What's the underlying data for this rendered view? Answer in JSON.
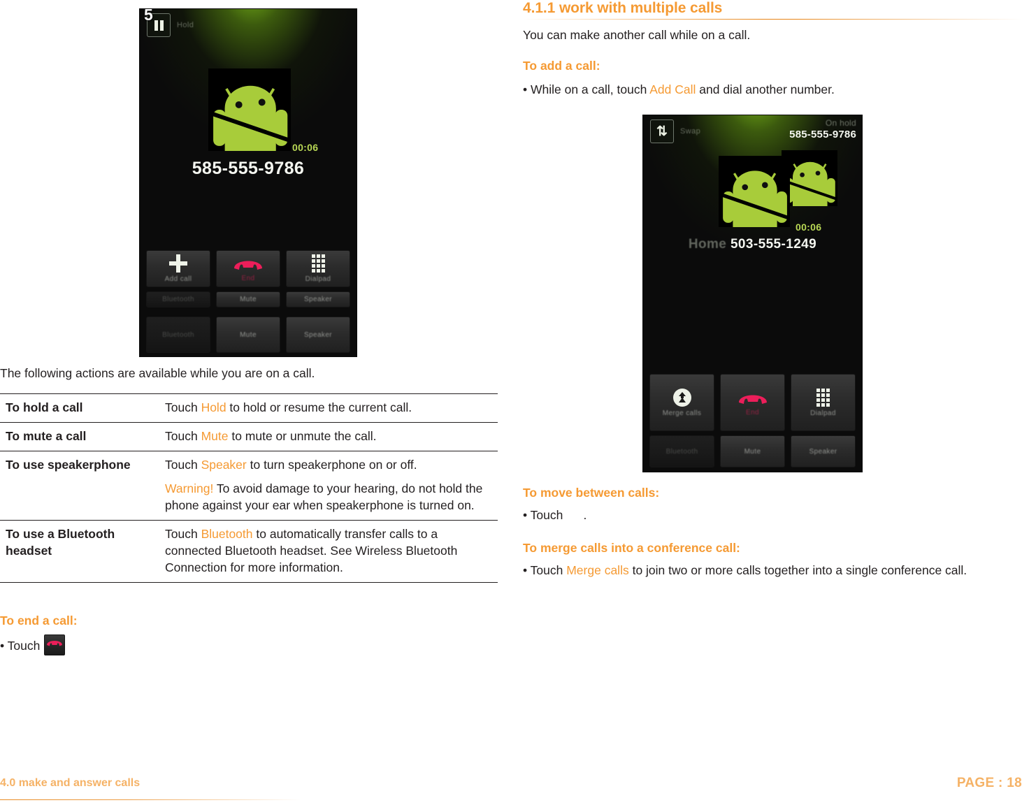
{
  "document": {
    "left_column": {
      "intro": "The following actions are available while you are on a call.",
      "table": {
        "rows": [
          {
            "key": "To hold a call",
            "lines": [
              [
                {
                  "t": "Touch ",
                  "c": "n"
                },
                {
                  "t": "Hold",
                  "c": "o"
                },
                {
                  "t": " to hold or resume the current call.",
                  "c": "n"
                }
              ]
            ]
          },
          {
            "key": "To mute a call",
            "lines": [
              [
                {
                  "t": "Touch ",
                  "c": "n"
                },
                {
                  "t": "Mute",
                  "c": "o"
                },
                {
                  "t": " to mute or unmute the call.",
                  "c": "n"
                }
              ]
            ]
          },
          {
            "key": "To use speakerphone",
            "lines": [
              [
                {
                  "t": "Touch ",
                  "c": "n"
                },
                {
                  "t": "Speaker",
                  "c": "o"
                },
                {
                  "t": " to turn speakerphone on or off.",
                  "c": "n"
                }
              ],
              [
                {
                  "t": "Warning!",
                  "c": "o"
                },
                {
                  "t": " To avoid damage to your hearing, do not hold the phone against your ear when speakerphone is turned on.",
                  "c": "n"
                }
              ]
            ]
          },
          {
            "key": "To use a Bluetooth headset",
            "lines": [
              [
                {
                  "t": "Touch ",
                  "c": "n"
                },
                {
                  "t": "Bluetooth",
                  "c": "o"
                },
                {
                  "t": " to automatically transfer calls to a connected Bluetooth headset. See Wireless Bluetooth Connection for more information.",
                  "c": "n"
                }
              ]
            ]
          }
        ]
      },
      "end_call_heading": "To end a call:",
      "end_call_bullet": "• Touch"
    },
    "right_column": {
      "section_heading": "4.1.1 work with multiple calls",
      "intro": "You can make another call while on a call.",
      "add_call_heading": "To add a call:",
      "add_call_bullet": [
        {
          "t": "• While on a call, touch ",
          "c": "n"
        },
        {
          "t": "Add Call",
          "c": "o"
        },
        {
          "t": " and dial another number.",
          "c": "n"
        }
      ],
      "move_heading": "To move between calls:",
      "move_bullet": "• Touch      .",
      "merge_heading": "To merge calls into a conference call:",
      "merge_bullet": [
        {
          "t": "• Touch ",
          "c": "n"
        },
        {
          "t": "Merge calls",
          "c": "o"
        },
        {
          "t": " to join two or more calls together into a single conference call.",
          "c": "n"
        }
      ]
    },
    "footer": {
      "left": "4.0 make and answer calls",
      "right": "PAGE : 18"
    }
  },
  "screenshot_one": {
    "callout_marker": "5",
    "hold_button_label": "Hold",
    "phone_number": "585-555-9786",
    "timer": "00:06",
    "buttons": [
      {
        "label": "Add call",
        "icon": "plus-icon",
        "state": "active"
      },
      {
        "label": "End",
        "icon": "end-call-icon",
        "state": "active"
      },
      {
        "label": "Dialpad",
        "icon": "keypad-icon",
        "state": "active"
      },
      {
        "label": "Bluetooth",
        "icon": "bluetooth-icon",
        "state": "disabled"
      },
      {
        "label": "Mute",
        "icon": "mute-icon",
        "state": "active"
      },
      {
        "label": "Speaker",
        "icon": "speaker-icon",
        "state": "active"
      }
    ]
  },
  "screenshot_two": {
    "swap_button_label": "Swap",
    "on_hold_label": "On hold",
    "on_hold_number": "585-555-9786",
    "active_label": "Home",
    "active_number": "503-555-1249",
    "timer": "00:06",
    "buttons": [
      {
        "label": "Merge calls",
        "icon": "merge-calls-icon",
        "state": "active"
      },
      {
        "label": "End",
        "icon": "end-call-icon",
        "state": "active"
      },
      {
        "label": "Dialpad",
        "icon": "keypad-icon",
        "state": "active"
      },
      {
        "label": "Bluetooth",
        "icon": "bluetooth-icon",
        "state": "disabled"
      },
      {
        "label": "Mute",
        "icon": "mute-icon",
        "state": "active"
      },
      {
        "label": "Speaker",
        "icon": "speaker-icon",
        "state": "active"
      }
    ]
  },
  "colors": {
    "accent_orange": "#f59a33",
    "footer_orange": "#f5b266",
    "text_black": "#231f20",
    "android_green": "#a4c639",
    "end_red": "#ec1e5a"
  }
}
